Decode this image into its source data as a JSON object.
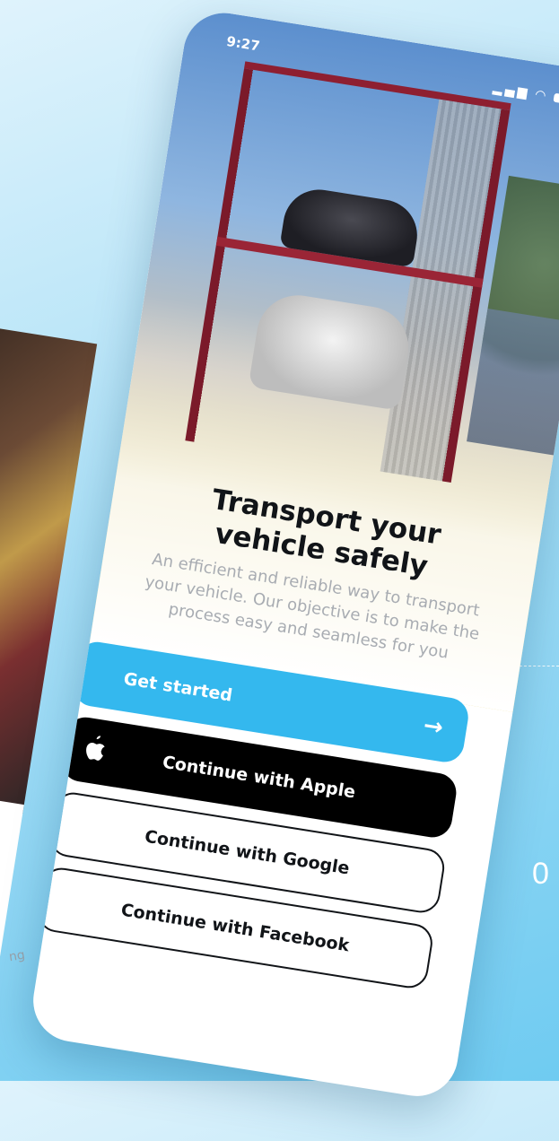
{
  "status": {
    "time": "9:27"
  },
  "onboarding": {
    "title": "Transport your vehicle safely",
    "subtitle": "An efficient and reliable way to transport your vehicle. Our objective is to make the process easy and seamless for you"
  },
  "buttons": {
    "get_started": "Get started",
    "apple": "Continue with Apple",
    "google": "Continue with Google",
    "facebook": "Continue with Facebook"
  },
  "background": {
    "left_snippet": "ng",
    "right_digit": "0"
  },
  "colors": {
    "primary": "#34b8ee",
    "dark": "#000000",
    "text": "#111418",
    "muted": "#a8acb2"
  }
}
